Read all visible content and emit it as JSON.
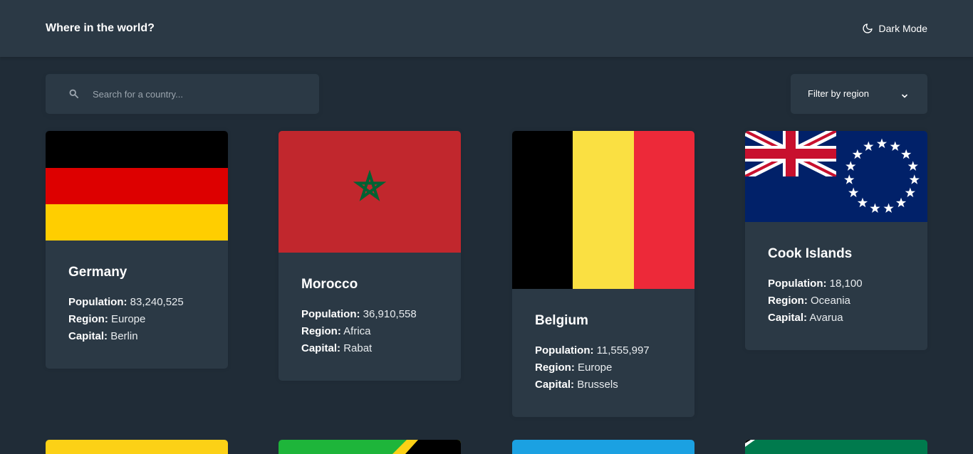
{
  "header": {
    "title": "Where in the world?",
    "theme_toggle_label": "Dark Mode",
    "theme_icon": "moon-icon"
  },
  "search": {
    "placeholder": "Search for a country...",
    "value": "",
    "icon": "search-icon"
  },
  "filter": {
    "label": "Filter by region",
    "icon": "chevron-down-icon"
  },
  "labels": {
    "population": "Population:",
    "region": "Region:",
    "capital": "Capital:"
  },
  "countries": [
    {
      "name": "Germany",
      "population": "83,240,525",
      "region": "Europe",
      "capital": "Berlin"
    },
    {
      "name": "Morocco",
      "population": "36,910,558",
      "region": "Africa",
      "capital": "Rabat"
    },
    {
      "name": "Belgium",
      "population": "11,555,997",
      "region": "Europe",
      "capital": "Brussels"
    },
    {
      "name": "Cook Islands",
      "population": "18,100",
      "region": "Oceania",
      "capital": "Avarua"
    }
  ],
  "colors": {
    "background": "#202c37",
    "surface": "#2b3945",
    "text": "#ffffff"
  }
}
